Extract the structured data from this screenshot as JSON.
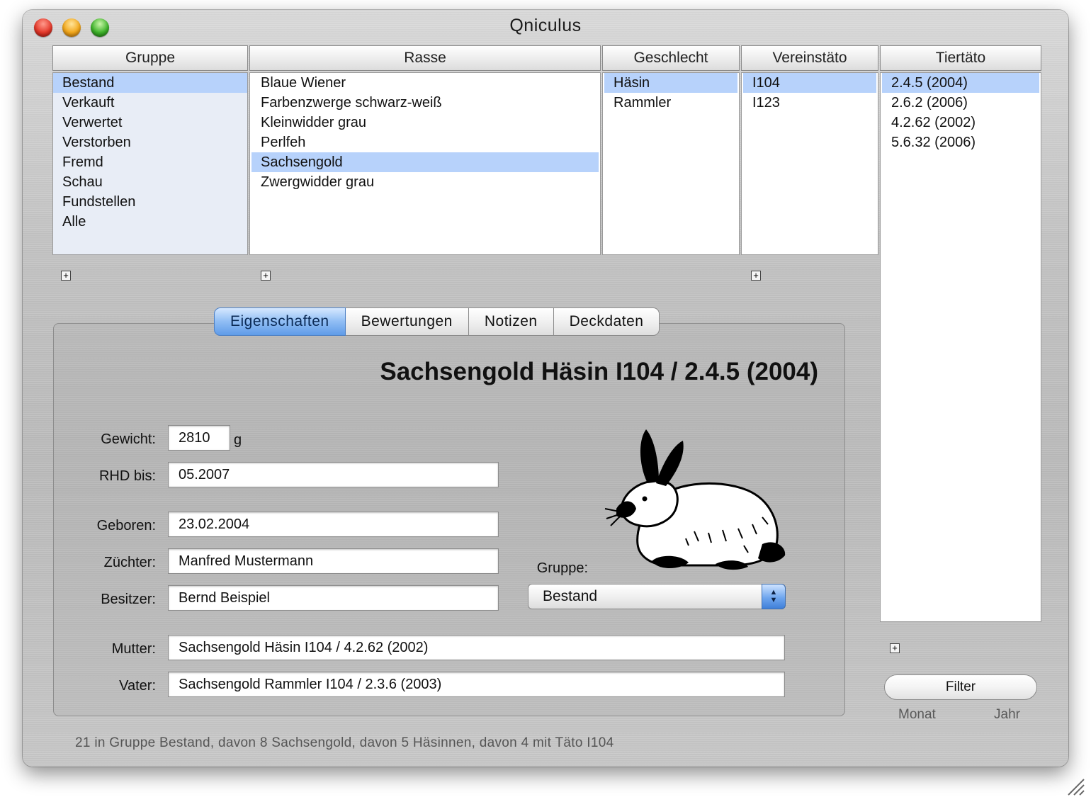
{
  "window": {
    "title": "Qniculus"
  },
  "browser": {
    "columns": [
      {
        "header": "Gruppe",
        "items": [
          "Bestand",
          "Verkauft",
          "Verwertet",
          "Verstorben",
          "Fremd",
          "Schau",
          "Fundstellen",
          "Alle"
        ],
        "selected": 0
      },
      {
        "header": "Rasse",
        "items": [
          "Blaue Wiener",
          "Farbenzwerge schwarz-weiß",
          "Kleinwidder grau",
          "Perlfeh",
          "Sachsengold",
          "Zwergwidder grau"
        ],
        "selected": 4
      },
      {
        "header": "Geschlecht",
        "items": [
          "Häsin",
          "Rammler"
        ],
        "selected": 0
      },
      {
        "header": "Vereinstäto",
        "items": [
          "I104",
          "I123"
        ],
        "selected": 0
      },
      {
        "header": "Tiertäto",
        "items": [
          "2.4.5 (2004)",
          "2.6.2 (2006)",
          "4.2.62 (2002)",
          "5.6.32 (2006)"
        ],
        "selected": 0
      }
    ]
  },
  "tabs": [
    "Eigenschaften",
    "Bewertungen",
    "Notizen",
    "Deckdaten"
  ],
  "active_tab": "Eigenschaften",
  "record": {
    "title": "Sachsengold Häsin I104 / 2.4.5 (2004)",
    "weight_label": "Gewicht:",
    "weight_value": "2810",
    "weight_unit": "g",
    "rhd_label": "RHD bis:",
    "rhd_value": "05.2007",
    "born_label": "Geboren:",
    "born_value": "23.02.2004",
    "breeder_label": "Züchter:",
    "breeder_value": "Manfred Mustermann",
    "owner_label": "Besitzer:",
    "owner_value": "Bernd Beispiel",
    "group_label": "Gruppe:",
    "group_value": "Bestand",
    "mother_label": "Mutter:",
    "mother_value": "Sachsengold Häsin I104 / 4.2.62 (2002)",
    "father_label": "Vater:",
    "father_value": "Sachsengold Rammler I104 / 2.3.6 (2003)"
  },
  "filter": {
    "button": "Filter",
    "month_label": "Monat",
    "year_label": "Jahr"
  },
  "status_text": "21 in Gruppe Bestand, davon 8 Sachsengold, davon 5 Häsinnen, davon 4 mit Täto I104",
  "colors": {
    "selection": "#b7d2fb",
    "aqua_accent": "#5f9be8"
  }
}
